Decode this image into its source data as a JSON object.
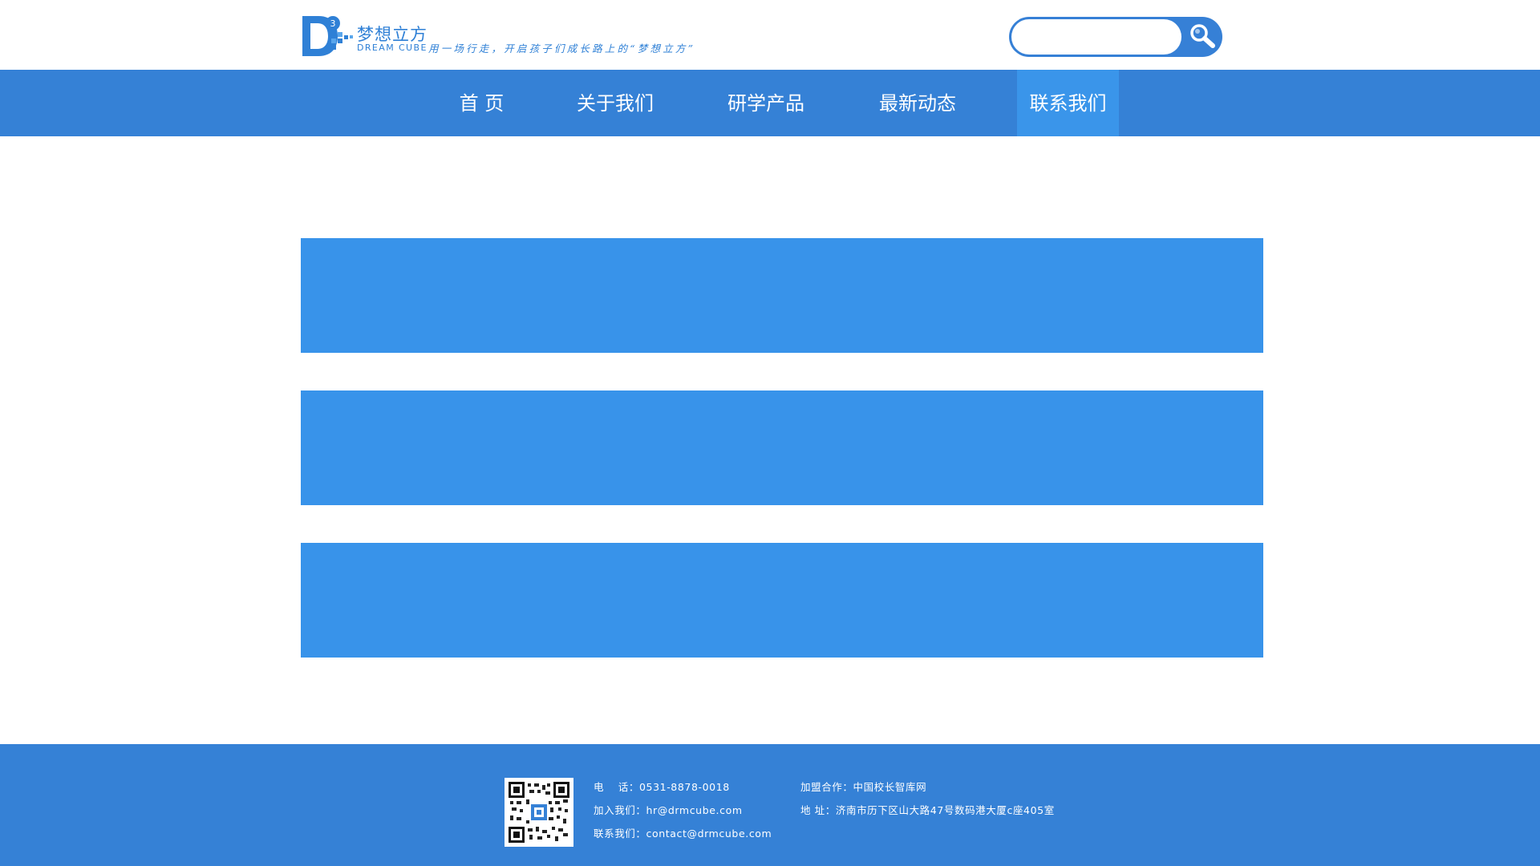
{
  "brand": {
    "logo_cn": "梦想立方",
    "logo_en": "DREAM CUBE",
    "logo_digit": "3",
    "slogan": "用一场行走，开启孩子们成长路上的“梦想立方”",
    "color_primary": "#3581d6",
    "color_active": "#3a95ea",
    "color_banner": "#3893ea"
  },
  "search": {
    "placeholder": "",
    "value": "",
    "button_icon": "magnifier-icon"
  },
  "nav": {
    "items": [
      {
        "label": "首 页",
        "active": false
      },
      {
        "label": "关于我们",
        "active": false
      },
      {
        "label": "研学产品",
        "active": false
      },
      {
        "label": "最新动态",
        "active": false
      },
      {
        "label": "联系我们",
        "active": true
      }
    ]
  },
  "content": {
    "banners": [
      "",
      "",
      ""
    ]
  },
  "footer": {
    "qr_icon": "qr-code-icon",
    "phone_label": "电　 话：",
    "phone_value": "0531-8878-0018",
    "join_label": "加入我们：",
    "join_value": "hr@drmcube.com",
    "contact_label": "联系我们：",
    "contact_value": "contact@drmcube.com",
    "partner_label": "加盟合作：",
    "partner_value": "中国校长智库网",
    "address_label": "地  址：",
    "address_value": "济南市历下区山大路47号数码港大厦c座405室"
  }
}
